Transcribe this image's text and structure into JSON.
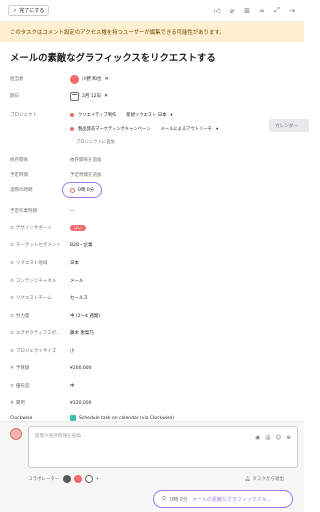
{
  "topbar": {
    "complete_label": "完了にする",
    "icons": [
      "like-icon",
      "attachment-icon",
      "subtask-icon",
      "link-icon",
      "expand-icon",
      "more-icon"
    ]
  },
  "banner": {
    "text": "このタスクはコメント設定のアクセス権を持つユーザーが編集できる可能性があります。"
  },
  "task": {
    "title": "メールの素敵なグラフィックスをリクエストする"
  },
  "fields": {
    "assignee": {
      "label": "担当者",
      "value": "川野 和也"
    },
    "due": {
      "label": "期日",
      "value": "2月 12日"
    },
    "projects": {
      "label": "プロジェクト",
      "p1_name": "クリエイティブ制作",
      "p1_section": "新規リクエスト 日本",
      "p2_name": "製品発売マーケティングキャンペーン",
      "p2_section": "メールによるアウトリーチ",
      "add": "プロジェクトに追加"
    },
    "dependency": {
      "label": "依存関係",
      "value": "依存関係を追加"
    },
    "estimated": {
      "label": "予定時間",
      "value": "予定時間を追加"
    },
    "actual": {
      "label": "実際の時間",
      "value": "0時 0分"
    },
    "done_date": {
      "label": "予定作業時間",
      "value": "—"
    },
    "design_support": {
      "label": "デザインサポート",
      "value": "はい"
    },
    "target_segment": {
      "label": "ターゲットセグメント",
      "value": "B2B・企業"
    },
    "request_region": {
      "label": "リクエスト地域",
      "value": "日本"
    },
    "content_channel": {
      "label": "コンテンツチャネル",
      "value": "メール"
    },
    "request_team": {
      "label": "リクエストチーム",
      "value": "セールス"
    },
    "effort": {
      "label": "労力量",
      "value": "中 (2〜4 週間)"
    },
    "exec_sponsor": {
      "label": "エグゼクティブスポ…",
      "value": "藤木 恵梨乃"
    },
    "project_size": {
      "label": "プロジェクトサイズ",
      "value": "小"
    },
    "budget": {
      "label": "予算額",
      "value": "¥200,000"
    },
    "priority": {
      "label": "優先度",
      "value": "中"
    },
    "spent": {
      "label": "費用",
      "value": "¥120,000"
    },
    "clockwise": {
      "label": "Clockwise",
      "value": "Schedule task on calendar (via Clockwise)"
    }
  },
  "calendar_button": "カレンダー",
  "comment": {
    "placeholder": "質問や進捗情報を投稿…",
    "collaborators_label": "コラボレーター",
    "leave_label": "タスクから退出"
  },
  "timer": {
    "time": "0時 0分",
    "task": "メールの素敵なグラフィックスキ…"
  },
  "colors": {
    "banner_bg": "#fdefcf",
    "highlight": "#9b7cf2",
    "accent_red": "#f06a6a"
  }
}
